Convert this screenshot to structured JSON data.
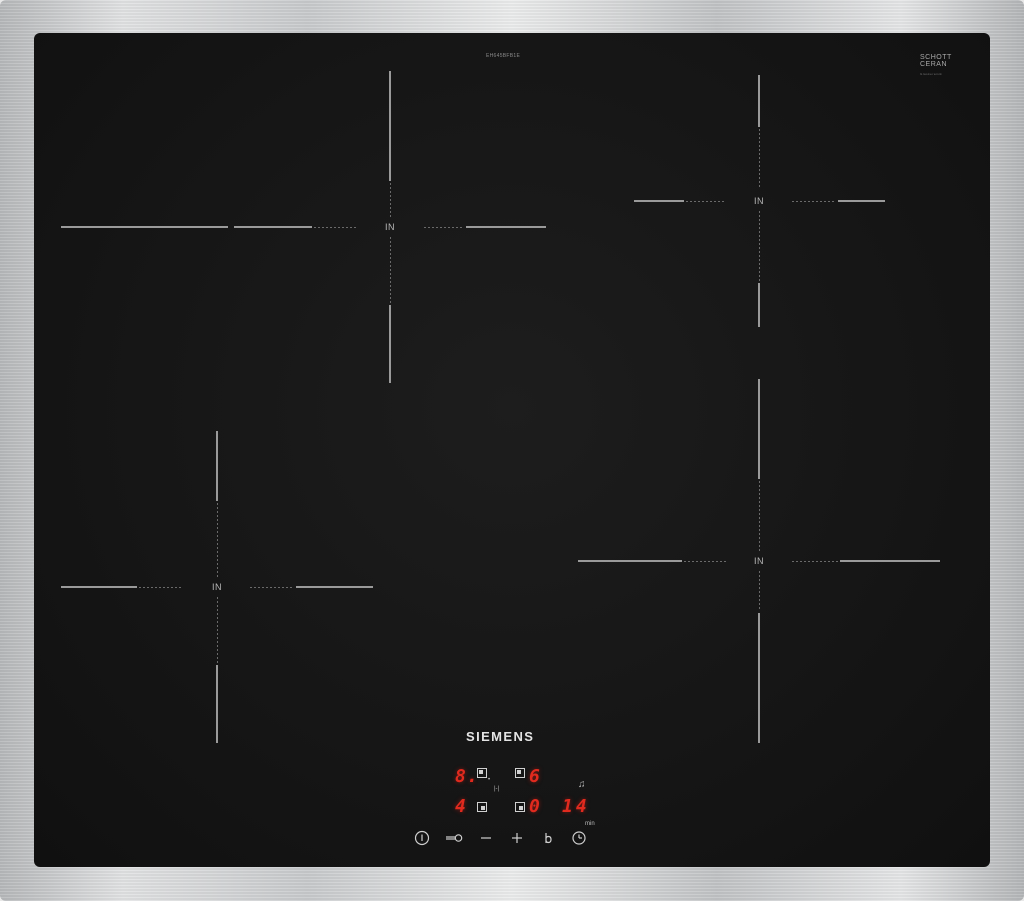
{
  "hob": {
    "model_code": "EH645BFB1E",
    "schott_label": "SCHOTT",
    "ceran_label": "CERAN",
    "schott_small": "Glaskeramik",
    "brand": "SIEMENS",
    "zone_label": "IN"
  },
  "display": {
    "top_left_digit": "8.",
    "top_right_digit": "6",
    "bottom_left_digit": "4",
    "bottom_right_digit": "0",
    "timer_value": "14",
    "timer_unit": "min",
    "link_symbol": "|-|"
  },
  "controls": [
    {
      "name": "power",
      "icon": "power-icon",
      "symbol": "⏻"
    },
    {
      "name": "child-lock",
      "icon": "key-icon",
      "symbol": "⊸"
    },
    {
      "name": "minus",
      "icon": "minus-icon",
      "symbol": "−"
    },
    {
      "name": "plus",
      "icon": "plus-icon",
      "symbol": "+"
    },
    {
      "name": "boost",
      "icon": "boost-icon",
      "symbol": "b"
    },
    {
      "name": "timer",
      "icon": "clock-icon",
      "symbol": "◷"
    }
  ],
  "colors": {
    "glass": "#141414",
    "display_red": "#e02a1e",
    "frame": "#c9cbcd"
  }
}
